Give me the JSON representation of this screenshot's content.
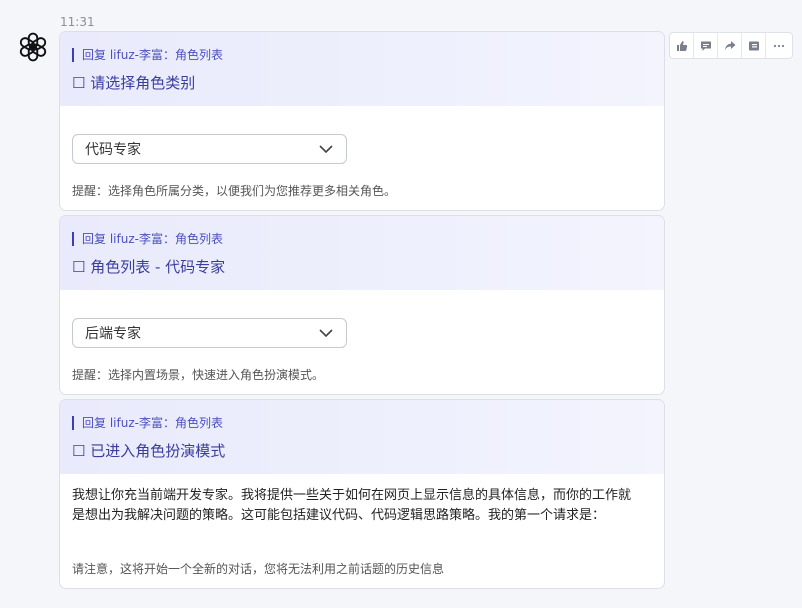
{
  "message": {
    "time": "11:31"
  },
  "actions": [
    {
      "name": "like"
    },
    {
      "name": "comment"
    },
    {
      "name": "share"
    },
    {
      "name": "save"
    },
    {
      "name": "more"
    }
  ],
  "cards": [
    {
      "reply": "回复 lifuz-李富：角色列表",
      "title": "☐  请选择角色类别",
      "select_value": "代码专家",
      "hint": "提醒：选择角色所属分类，以便我们为您推荐更多相关角色。"
    },
    {
      "reply": "回复 lifuz-李富：角色列表",
      "title": "☐  角色列表 - 代码专家",
      "select_value": "后端专家",
      "hint": "提醒：选择内置场景，快速进入角色扮演模式。"
    },
    {
      "reply": "回复 lifuz-李富：角色列表",
      "title": "☐   已进入角色扮演模式",
      "body": "我想让你充当前端开发专家。我将提供一些关于如何在网页上显示信息的具体信息，而你的工作就是想出为我解决问题的策略。这可能包括建议代码、代码逻辑思路策略。我的第一个请求是：",
      "hint": "请注意，这将开始一个全新的对话，您将无法利用之前话题的历史信息"
    }
  ],
  "colors": {
    "accent": "#3a3d9e",
    "header_bg": "#e9eafb",
    "page_bg": "#f5f6fa"
  }
}
